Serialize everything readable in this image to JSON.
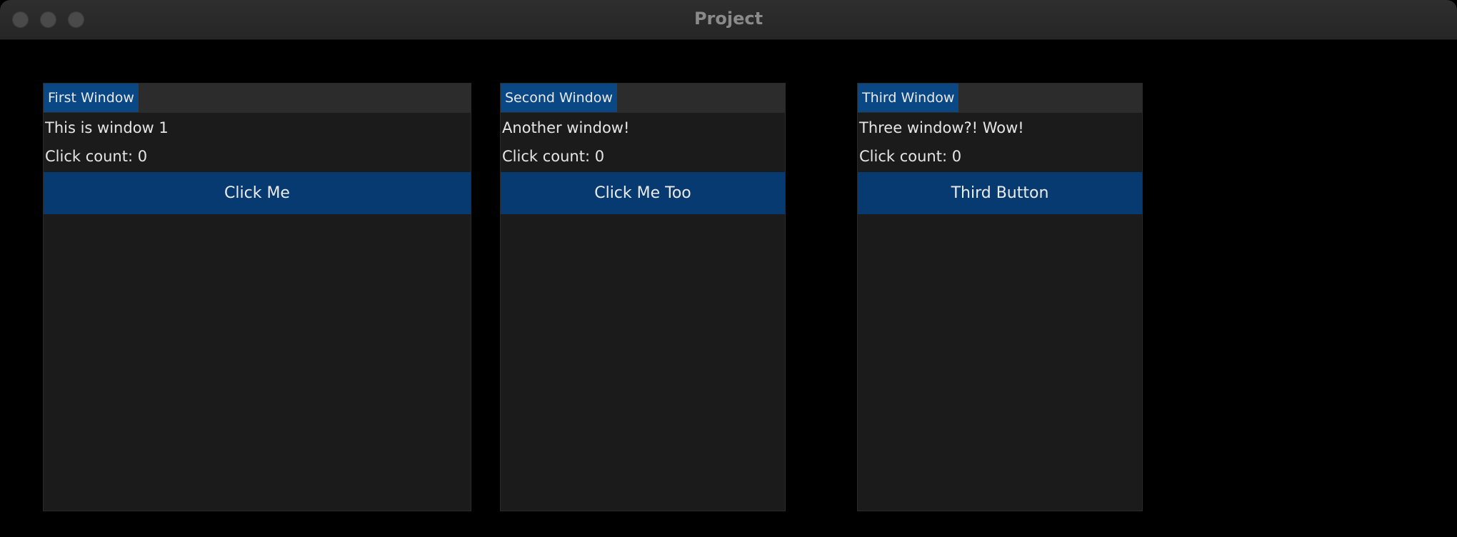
{
  "app": {
    "title": "Project"
  },
  "colors": {
    "background": "#000000",
    "window_bg": "#1b1b1b",
    "title_tab": "#0a4785",
    "button": "#073a70",
    "text": "#e6e6e6"
  },
  "windows": [
    {
      "title": "First Window",
      "text": "This is window 1",
      "click_count": "Click count: 0",
      "button_label": "Click Me"
    },
    {
      "title": "Second Window",
      "text": "Another window!",
      "click_count": "Click count: 0",
      "button_label": "Click Me Too"
    },
    {
      "title": "Third Window",
      "text": "Three window?! Wow!",
      "click_count": "Click count: 0",
      "button_label": "Third Button"
    }
  ]
}
